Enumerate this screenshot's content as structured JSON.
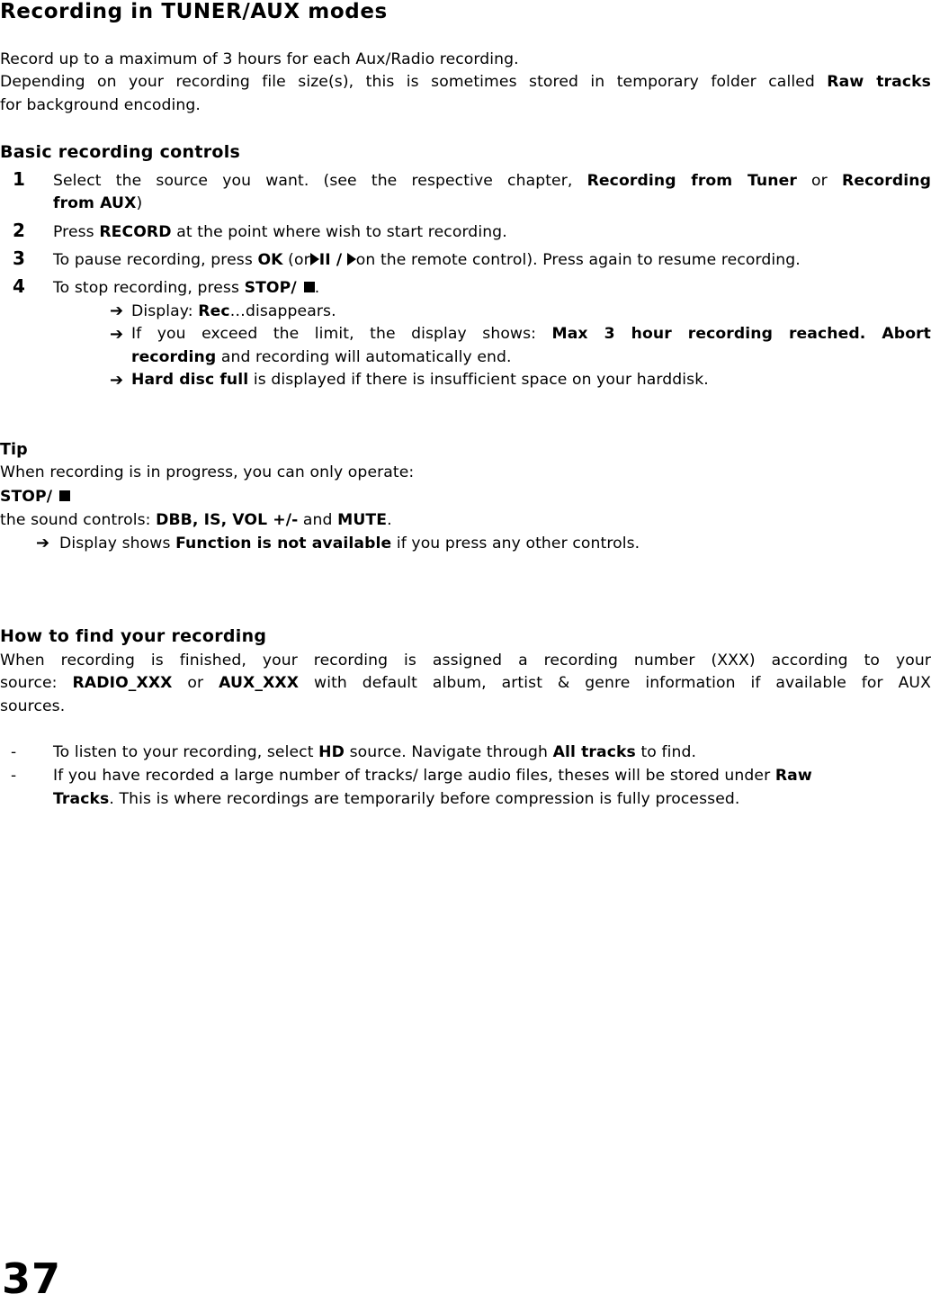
{
  "document": {
    "title": "Recording in TUNER/AUX modes",
    "intro": {
      "line1": "Record up to a maximum of 3 hours for each Aux/Radio recording.",
      "line2_pre": "Depending on your recording file size(s), this is sometimes stored in temporary folder called",
      "line2_bold": "Raw tracks",
      "line3": "for background encoding."
    },
    "basic_controls": {
      "heading": "Basic recording controls",
      "steps": [
        {
          "number": "1",
          "pre": "Select the source you want. (see the respective chapter,",
          "bold1": "Recording from Tuner",
          "mid": "or",
          "bold2": "Recording",
          "cont_bold": "from AUX",
          "cont_post": ")"
        },
        {
          "number": "2",
          "pre": "Press",
          "bold": "RECORD",
          "post": "at the point where wish to start recording."
        },
        {
          "number": "3",
          "pre": "To pause recording, press",
          "bold": "OK",
          "mid": "(or",
          "playpause_label": "II /",
          "post": "on the remote control). Press again to resume recording.",
          "icons": [
            "play-pause-icon",
            "play-icon"
          ]
        },
        {
          "number": "4",
          "pre": "To stop recording, press",
          "bold": "STOP/",
          "post": ".",
          "icons": [
            "stop-icon"
          ],
          "results": [
            {
              "pre": "Display:",
              "bold": "Rec",
              "post": "…disappears."
            },
            {
              "pre": "If you exceed the limit, the display shows:",
              "bold": "Max 3 hour recording reached.  Abort",
              "cont_bold": "recording",
              "cont_post": "and recording will automatically end."
            },
            {
              "bold": "Hard disc full",
              "post": "is displayed if there is insufficient space on your harddisk."
            }
          ]
        }
      ]
    },
    "tip": {
      "heading": "Tip",
      "line1": "When recording is in progress, you can only operate:",
      "line2_bold": "STOP/",
      "line3_pre": "the sound controls:",
      "line3_bold1": "DBB, IS, VOL +/-",
      "line3_mid": "and",
      "line3_bold2": "MUTE",
      "line3_post": ".",
      "result_pre": "Display shows",
      "result_bold": "Function is not available",
      "result_post": "if you press any other controls."
    },
    "find": {
      "heading": "How to find your recording",
      "para_line1": "When recording is finished, your recording is assigned a recording number (XXX) according to your",
      "para_line2_pre": "source:",
      "para_line2_bold1": "RADIO_XXX",
      "para_line2_mid": "or",
      "para_line2_bold2": "AUX_XXX",
      "para_line2_post": "with default album, artist & genre information if available for AUX",
      "para_line3": "sources.",
      "bullets": [
        {
          "marker": "-",
          "pre": "To listen to your recording, select",
          "bold1": "HD",
          "mid": "source. Navigate through",
          "bold2": "All tracks",
          "post": "to find."
        },
        {
          "marker": "-",
          "pre": "If you have recorded a large number of tracks/ large audio files, theses will be stored under",
          "bold": "Raw",
          "cont_bold": "Tracks",
          "cont_post": ". This is where recordings are temporarily before compression is fully processed."
        }
      ]
    },
    "page_number": "37"
  }
}
